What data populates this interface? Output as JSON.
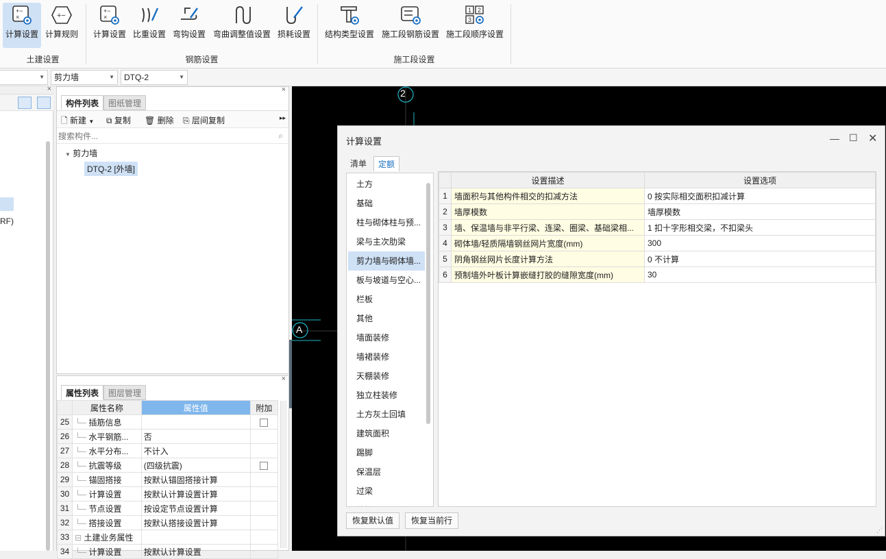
{
  "ribbon": {
    "buttons": [
      {
        "label": "计算设置",
        "icon": "calc-settings-icon",
        "active": true
      },
      {
        "label": "计算规则",
        "icon": "calc-rules-icon",
        "active": false
      },
      {
        "label": "计算设置",
        "icon": "rebar-calc-settings-icon",
        "active": false
      },
      {
        "label": "比重设置",
        "icon": "density-settings-icon",
        "active": false
      },
      {
        "label": "弯钩设置",
        "icon": "hook-settings-icon",
        "active": false
      },
      {
        "label": "弯曲调整值设置",
        "icon": "bend-adjust-icon",
        "active": false
      },
      {
        "label": "损耗设置",
        "icon": "loss-settings-icon",
        "active": false
      },
      {
        "label": "结构类型设置",
        "icon": "structure-type-icon",
        "active": false
      },
      {
        "label": "施工段钢筋设置",
        "icon": "stage-rebar-icon",
        "active": false
      },
      {
        "label": "施工段顺序设置",
        "icon": "stage-order-icon",
        "active": false
      }
    ],
    "groups": [
      "土建设置",
      "钢筋设置",
      "施工段设置"
    ]
  },
  "filter": {
    "combo1": "剪力墙",
    "combo2": "DTQ-2"
  },
  "left": {
    "partial_text": "RF)"
  },
  "components": {
    "tabs": [
      "构件列表",
      "图纸管理"
    ],
    "toolbar": {
      "new": "新建",
      "copy": "复制",
      "delete": "删除",
      "floor_copy": "层间复制"
    },
    "search_placeholder": "搜索构件...",
    "tree_parent": "剪力墙",
    "tree_child": "DTQ-2 [外墙]"
  },
  "properties": {
    "tabs": [
      "属性列表",
      "图层管理"
    ],
    "headers": [
      "属性名称",
      "属性值",
      "附加"
    ],
    "rows": [
      {
        "n": "25",
        "name": "插筋信息",
        "value": "",
        "checkbox": true
      },
      {
        "n": "26",
        "name": "水平钢筋...",
        "value": "否",
        "checkbox": false
      },
      {
        "n": "27",
        "name": "水平分布...",
        "value": "不计入",
        "checkbox": false
      },
      {
        "n": "28",
        "name": "抗震等级",
        "value": "(四级抗震)",
        "checkbox": true
      },
      {
        "n": "29",
        "name": "锚固搭接",
        "value": "按默认锚固搭接计算",
        "checkbox": false
      },
      {
        "n": "30",
        "name": "计算设置",
        "value": "按默认计算设置计算",
        "checkbox": false
      },
      {
        "n": "31",
        "name": "节点设置",
        "value": "按设定节点设置计算",
        "checkbox": false
      },
      {
        "n": "32",
        "name": "搭接设置",
        "value": "按默认搭接设置计算",
        "checkbox": false
      },
      {
        "n": "33",
        "name": "土建业务属性",
        "value": "",
        "checkbox": false
      },
      {
        "n": "34",
        "name": "计算设置",
        "value": "按默认计算设置",
        "checkbox": false
      }
    ]
  },
  "canvas": {
    "axis_top": "2",
    "axis_left": "A"
  },
  "dialog": {
    "title": "计算设置",
    "tabs": [
      "清单",
      "定额"
    ],
    "categories": [
      "土方",
      "基础",
      "柱与砌体柱与预...",
      "梁与主次肋梁",
      "剪力墙与砌体墙...",
      "板与坡道与空心...",
      "栏板",
      "其他",
      "墙面装修",
      "墙裙装修",
      "天棚装修",
      "独立柱装修",
      "土方灰土回填",
      "建筑面积",
      "踢脚",
      "保温层",
      "过梁",
      "楼梯面"
    ],
    "selected_category": 4,
    "table_headers": [
      "设置描述",
      "设置选项"
    ],
    "rows": [
      {
        "n": "1",
        "desc": "墙面积与其他构件相交的扣减方法",
        "opt": "0 按实际相交面积扣减计算"
      },
      {
        "n": "2",
        "desc": "墙厚模数",
        "opt": "墙厚模数"
      },
      {
        "n": "3",
        "desc": "墙、保温墙与非平行梁、连梁、圈梁、基础梁相...",
        "opt": "1 扣十字形相交梁，不扣梁头"
      },
      {
        "n": "4",
        "desc": "砌体墙/轻质隔墙钢丝网片宽度(mm)",
        "opt": "300"
      },
      {
        "n": "5",
        "desc": "阴角钢丝网片长度计算方法",
        "opt": "0 不计算"
      },
      {
        "n": "6",
        "desc": "预制墙外叶板计算嵌缝打胶的缝隙宽度(mm)",
        "opt": "30"
      }
    ],
    "buttons": {
      "restore_default": "恢复默认值",
      "restore_row": "恢复当前行"
    }
  }
}
